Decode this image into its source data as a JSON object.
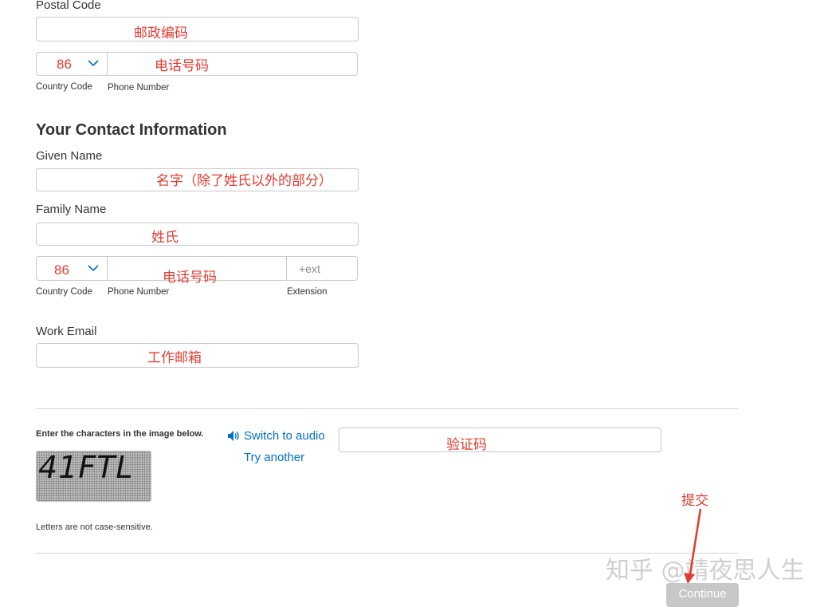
{
  "postal": {
    "label": "Postal Code",
    "annotation": "邮政编码"
  },
  "phone1": {
    "country_code_value": "86",
    "annotation": "电话号码",
    "country_code_label": "Country Code",
    "phone_label": "Phone Number"
  },
  "contact": {
    "heading": "Your Contact Information",
    "given_name_label": "Given Name",
    "given_name_annotation": "名字（除了姓氏以外的部分）",
    "family_name_label": "Family Name",
    "family_name_annotation": "姓氏"
  },
  "phone2": {
    "country_code_value": "86",
    "annotation": "电话号码",
    "extension_placeholder": "+ext",
    "country_code_label": "Country Code",
    "phone_label": "Phone Number",
    "extension_label": "Extension"
  },
  "work_email": {
    "label": "Work Email",
    "annotation": "工作邮箱"
  },
  "captcha": {
    "instruction": "Enter the characters in the image below.",
    "switch_audio": "Switch to audio",
    "try_another": "Try another",
    "image_text": "41FTL",
    "input_annotation": "验证码",
    "note": "Letters are not case-sensitive."
  },
  "submit": {
    "annotation": "提交",
    "button_label": "Continue"
  },
  "watermark": "知乎 @靖夜思人生",
  "colors": {
    "annotation": "#e03c31",
    "link": "#0070c9",
    "button_disabled": "#c7c7c7"
  },
  "icons": {
    "chevron": "chevron-down-icon",
    "speaker": "speaker-icon",
    "arrow": "red-arrow"
  }
}
